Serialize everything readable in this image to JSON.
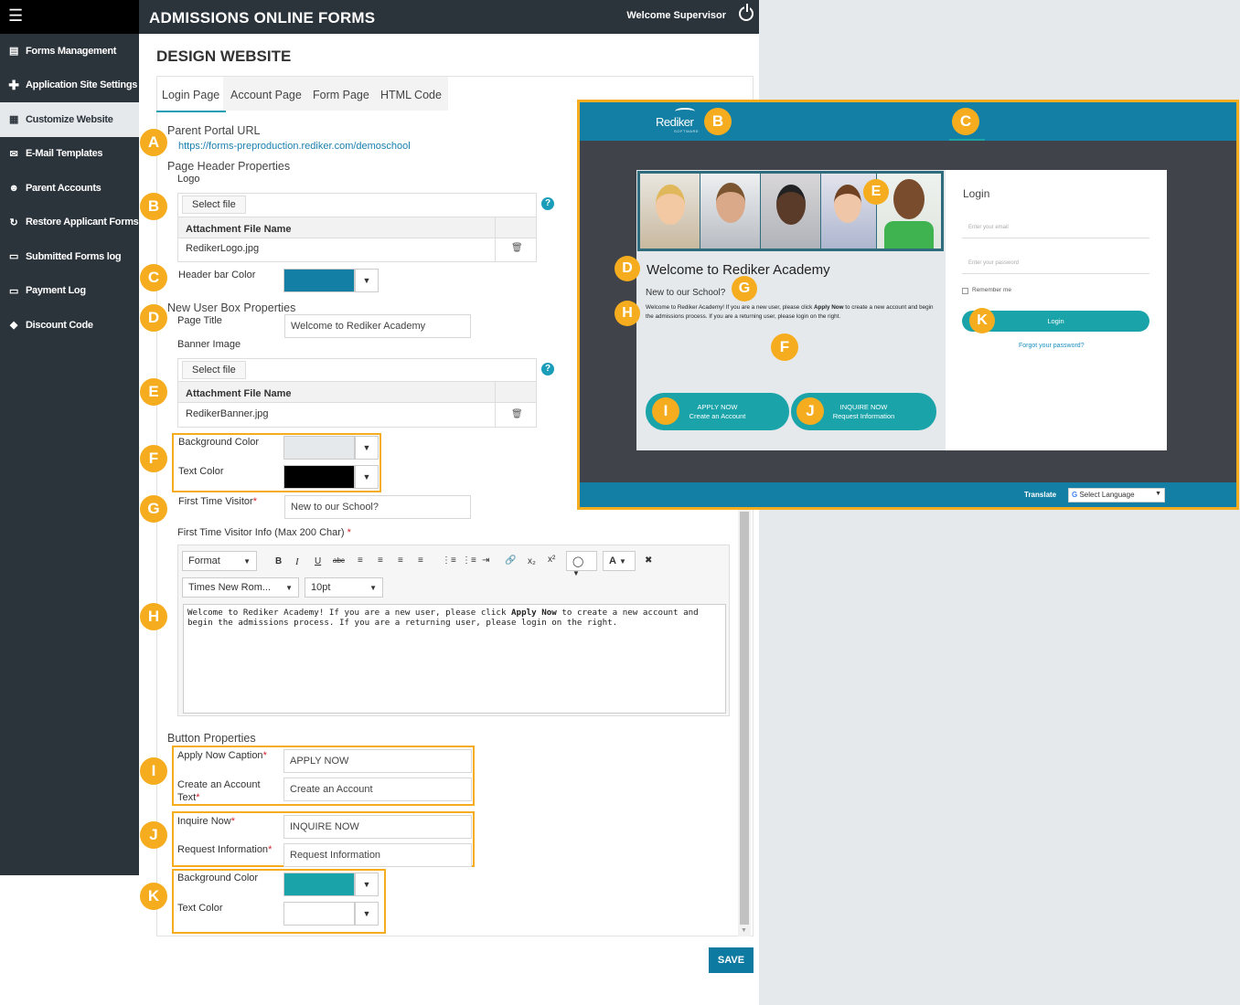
{
  "sidebar": {
    "items": [
      {
        "label": "Forms Management",
        "icon": "list-icon"
      },
      {
        "label": "Application Site Settings",
        "icon": "plus-icon"
      },
      {
        "label": "Customize Website",
        "icon": "grid-icon",
        "active": true
      },
      {
        "label": "E-Mail Templates",
        "icon": "envelope-icon"
      },
      {
        "label": "Parent Accounts",
        "icon": "users-icon"
      },
      {
        "label": "Restore Applicant Forms",
        "icon": "refresh-icon"
      },
      {
        "label": "Submitted Forms log",
        "icon": "file-icon"
      },
      {
        "label": "Payment Log",
        "icon": "file-icon"
      },
      {
        "label": "Discount Code",
        "icon": "tag-icon"
      }
    ]
  },
  "topbar": {
    "title": "ADMISSIONS ONLINE FORMS",
    "welcome": "Welcome Supervisor"
  },
  "page_title": "DESIGN WEBSITE",
  "tabs": [
    "Login Page",
    "Account Page",
    "Form Page",
    "HTML Code"
  ],
  "form": {
    "parent_portal_label": "Parent Portal URL",
    "parent_portal_url": "https://forms-preproduction.rediker.com/demoschool",
    "page_header_section": "Page Header Properties",
    "logo_label": "Logo",
    "select_file": "Select file",
    "attachment_header": "Attachment File Name",
    "logo_file": "RedikerLogo.jpg",
    "header_bar_color_label": "Header bar Color",
    "new_user_section": "New User Box Properties",
    "page_title_label": "Page Title",
    "page_title_value": "Welcome to Rediker Academy",
    "banner_label": "Banner Image",
    "banner_file": "RedikerBanner.jpg",
    "bg_color_label": "Background Color",
    "text_color_label": "Text Color",
    "first_visitor_label": "First Time Visitor",
    "first_visitor_value": "New to our School?",
    "visitor_info_label": "First Time Visitor Info (Max 200 Char)",
    "editor": {
      "format": "Format",
      "font": "Times New Rom...",
      "size": "10pt",
      "text_before": "Welcome to Rediker Academy! If you are a new user, please click ",
      "text_bold": "Apply Now",
      "text_after": " to create a new account and begin the admissions process.  If you are a returning user, please login on the right."
    },
    "button_section": "Button Properties",
    "apply_caption_label": "Apply Now Caption",
    "apply_caption_value": "APPLY NOW",
    "create_account_label_1": "Create an Account",
    "create_account_label_2": "Text",
    "create_account_value": "Create an Account",
    "inquire_label": "Inquire Now",
    "inquire_value": "INQUIRE NOW",
    "request_label": "Request Information",
    "request_value": "Request Information",
    "btn_bg_color_label": "Background Color",
    "btn_text_color_label": "Text Color",
    "required_mark": "*",
    "save": "SAVE"
  },
  "colors": {
    "header_bar": "#137fa4",
    "new_user_bg": "#e6e9ec",
    "new_user_text": "#000000",
    "button_bg": "#1aa4a9",
    "highlight": "#f5ad1f"
  },
  "badges": {
    "a": "A",
    "b": "B",
    "c": "C",
    "d": "D",
    "e": "E",
    "f": "F",
    "g": "G",
    "h": "H",
    "i": "I",
    "j": "J",
    "k": "K"
  },
  "preview": {
    "logo": "Rediker",
    "logo_sub": "SOFTWARE",
    "welcome": "Welcome to Rediker Academy",
    "new_school": "New to our School?",
    "info_before": "Welcome to Rediker Academy! If you are a new user, please click ",
    "info_bold": "Apply Now",
    "info_after": " to create a new account and begin the admissions process.  If you are a returning user, please login on the right.",
    "apply_title": "APPLY NOW",
    "apply_sub": "Create an Account",
    "inquire_title": "INQUIRE NOW",
    "inquire_sub": "Request Information",
    "login_title": "Login",
    "email_placeholder": "Enter your email",
    "password_placeholder": "Enter your password",
    "remember": "Remember me",
    "login_button": "Login",
    "forgot": "Forgot your password?",
    "translate": "Translate",
    "select_language": "Select Language"
  }
}
